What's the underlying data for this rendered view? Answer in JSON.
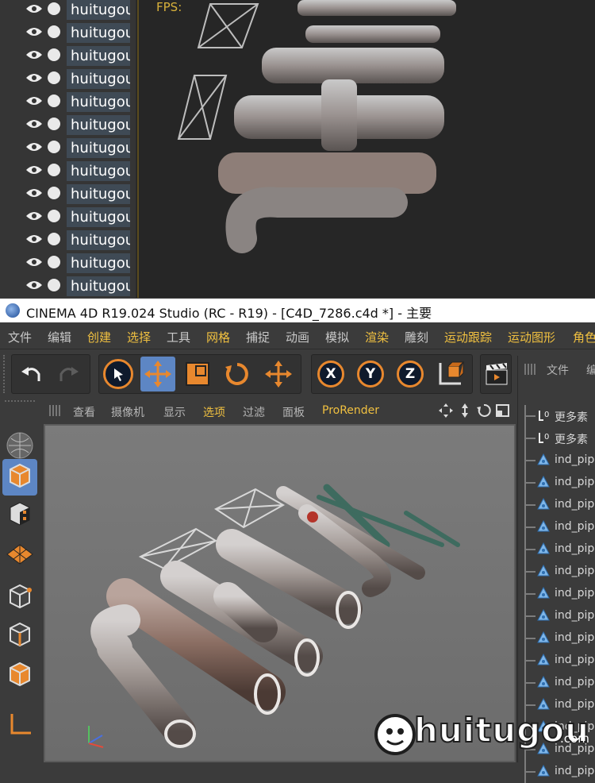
{
  "top_object_manager": {
    "rows": [
      "huitugou",
      "huitugou",
      "huitugou",
      "huitugou",
      "huitugou",
      "huitugou",
      "huitugou",
      "huitugou",
      "huitugou",
      "huitugou",
      "huitugou",
      "huitugou",
      "huitugou"
    ]
  },
  "top_viewport": {
    "fps_label": "FPS:"
  },
  "titlebar": {
    "title": "CINEMA 4D R19.024 Studio (RC - R19) - [C4D_7286.c4d *] - 主要"
  },
  "menubar": {
    "items": [
      "文件",
      "编辑",
      "创建",
      "选择",
      "工具",
      "网格",
      "捕捉",
      "动画",
      "模拟",
      "渲染",
      "雕刻",
      "运动跟踪",
      "运动图形",
      "角色"
    ]
  },
  "toolbar": {
    "axis_x": "X",
    "axis_y": "Y",
    "axis_z": "Z"
  },
  "viewport_menu": {
    "items": [
      "查看",
      "摄像机",
      "显示",
      "选项",
      "过滤",
      "面板",
      "ProRender"
    ]
  },
  "right_panel": {
    "header": [
      "文件",
      "编"
    ],
    "rows": [
      {
        "icon": "null-icon",
        "label": "更多素"
      },
      {
        "icon": "null-icon",
        "label": "更多素"
      },
      {
        "icon": "polygon-icon",
        "label": "ind_pip"
      },
      {
        "icon": "polygon-icon",
        "label": "ind_pip"
      },
      {
        "icon": "polygon-icon",
        "label": "ind_pip"
      },
      {
        "icon": "polygon-icon",
        "label": "ind_pip"
      },
      {
        "icon": "polygon-icon",
        "label": "ind_pip"
      },
      {
        "icon": "polygon-icon",
        "label": "ind_pip"
      },
      {
        "icon": "polygon-icon",
        "label": "ind_pip"
      },
      {
        "icon": "polygon-icon",
        "label": "ind_pip"
      },
      {
        "icon": "polygon-icon",
        "label": "ind_pip"
      },
      {
        "icon": "polygon-icon",
        "label": "ind_pip"
      },
      {
        "icon": "polygon-icon",
        "label": "ind_pip"
      },
      {
        "icon": "polygon-icon",
        "label": "ind_pip"
      },
      {
        "icon": "polygon-icon",
        "label": "ind_pip"
      },
      {
        "icon": "polygon-icon",
        "label": "ind_pip"
      },
      {
        "icon": "polygon-icon",
        "label": "ind_pip"
      }
    ]
  },
  "watermark": {
    "text": "huitugou",
    "suffix": ".com"
  },
  "colors": {
    "accent": "#e8882e",
    "selection": "#5d86c4",
    "menu_yellow": "#f0c040"
  }
}
